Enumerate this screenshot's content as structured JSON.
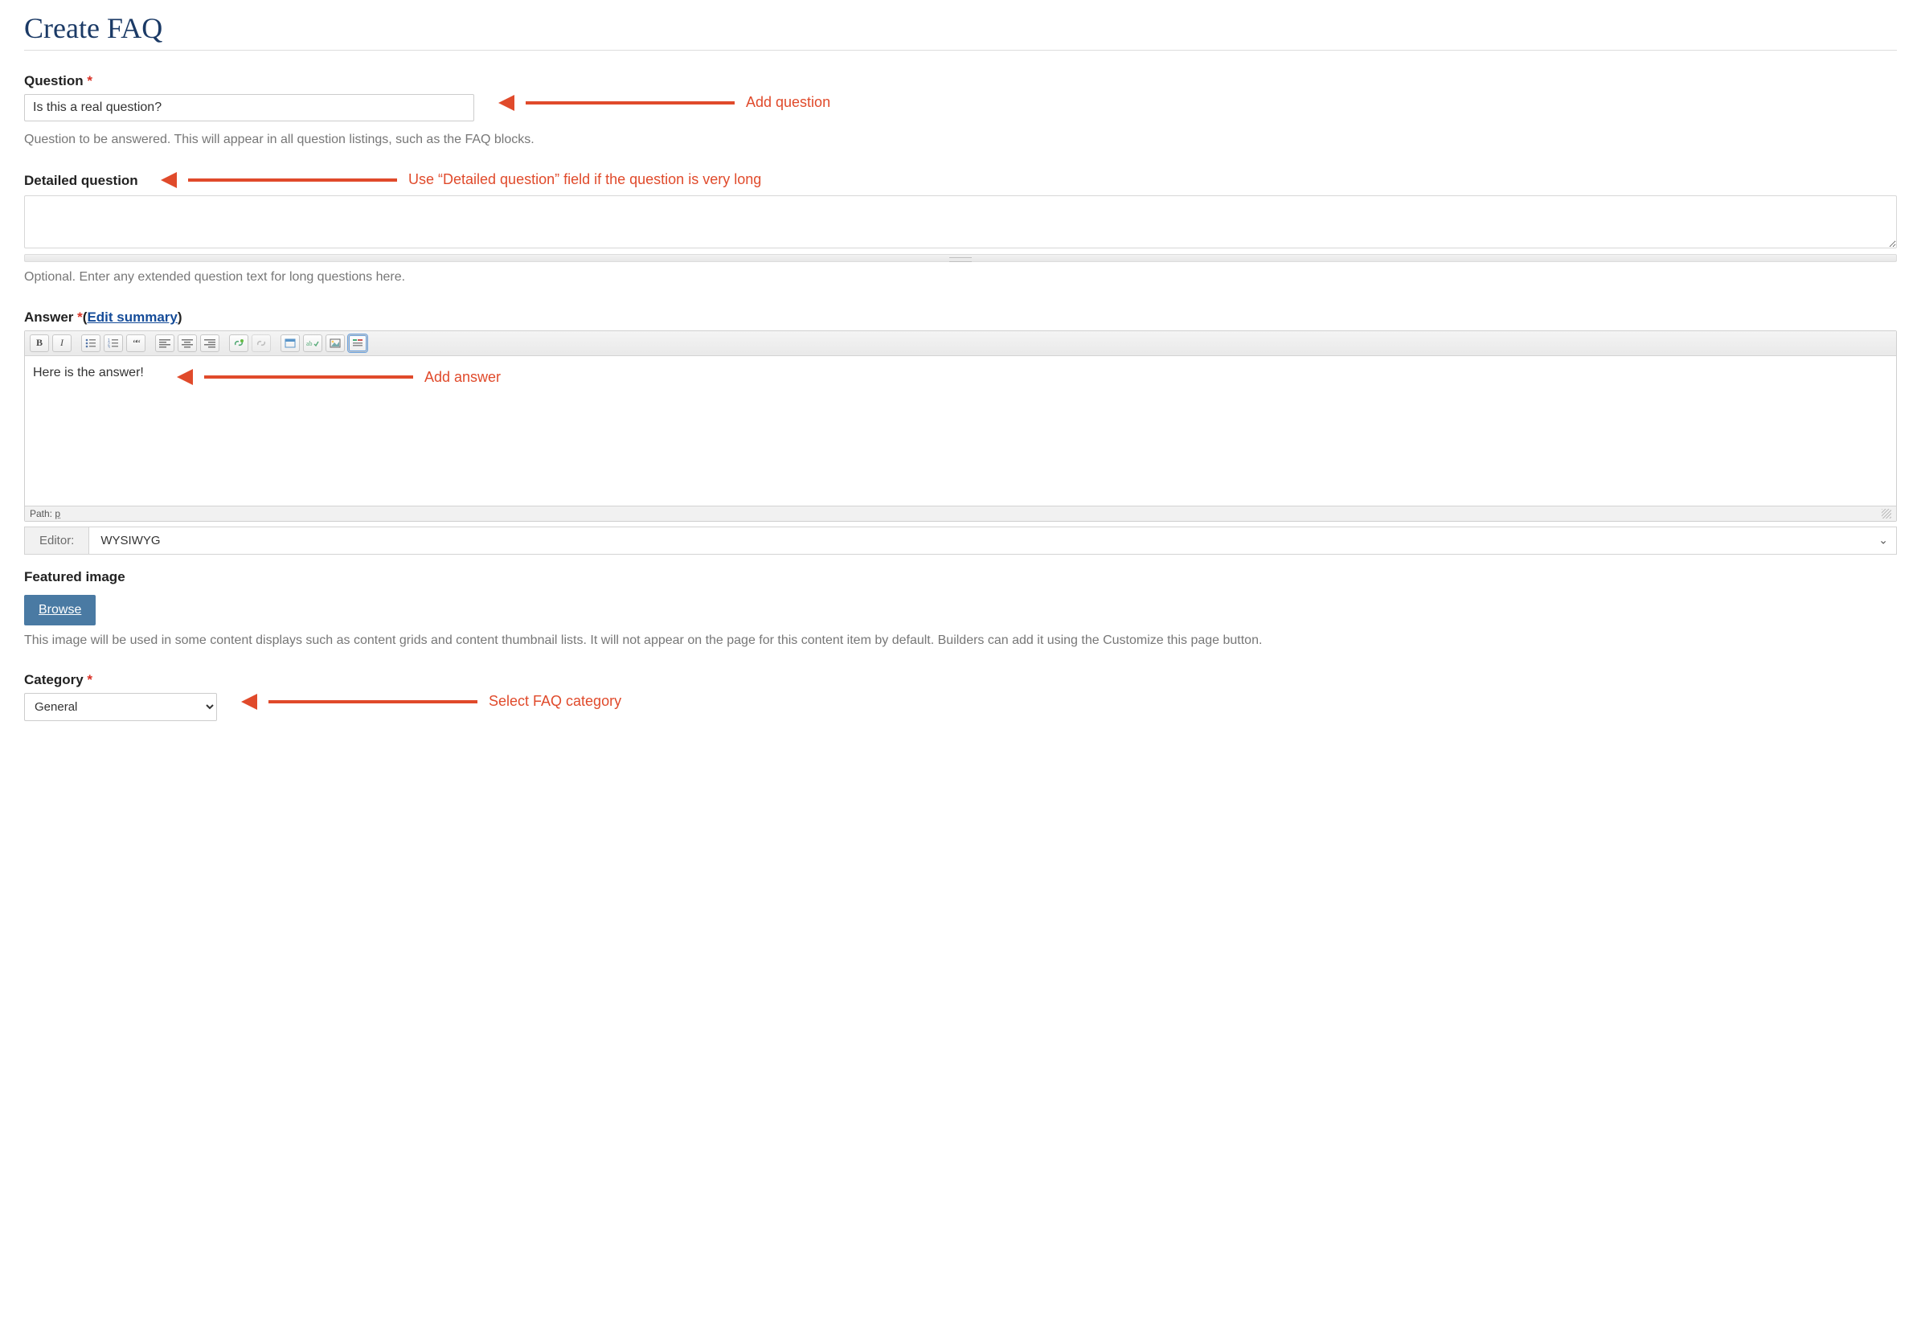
{
  "page": {
    "title": "Create FAQ"
  },
  "question": {
    "label": "Question",
    "value": "Is this a real question?",
    "help": "Question to be answered. This will appear in all question listings, such as the FAQ blocks."
  },
  "detailed": {
    "label": "Detailed question",
    "value": "",
    "help": "Optional. Enter any extended question text for long questions here."
  },
  "answer": {
    "label": "Answer",
    "edit_summary": "Edit summary",
    "body": "Here is the answer!",
    "path_label": "Path:",
    "path_element": "p",
    "editor_label": "Editor:",
    "editor_value": "WYSIWYG"
  },
  "featured_image": {
    "label": "Featured image",
    "browse": "Browse",
    "help": "This image will be used in some content displays such as content grids and content thumbnail lists. It will not appear on the page for this content item by default. Builders can add it using the Customize this page button."
  },
  "category": {
    "label": "Category",
    "selected": "General",
    "options": [
      "General"
    ]
  },
  "annotations": {
    "question": "Add question",
    "detailed": "Use “Detailed question” field if the question is very long",
    "answer": "Add answer",
    "category": "Select FAQ category"
  },
  "toolbar": {
    "bold": "B",
    "italic": "I"
  },
  "colors": {
    "accent_red": "#e04a2b",
    "title_blue": "#1b3a66",
    "link_blue": "#154c99",
    "button_blue": "#4a7aa3"
  }
}
